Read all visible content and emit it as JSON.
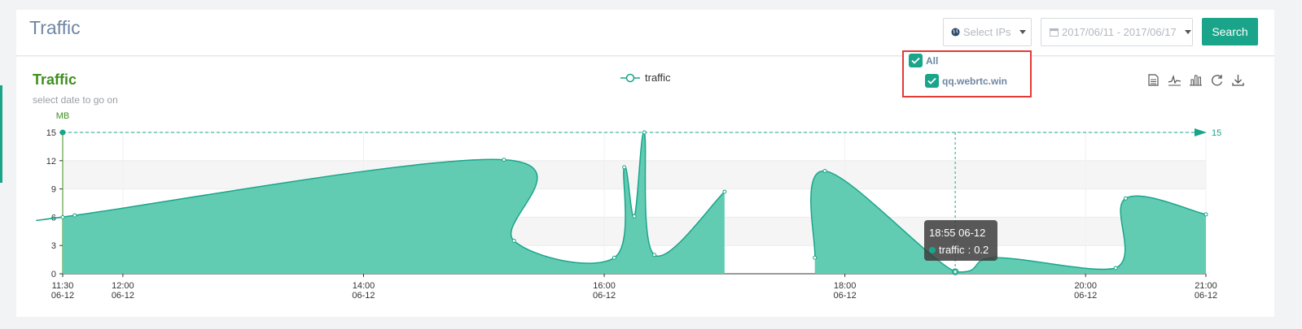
{
  "header": {
    "title": "Traffic",
    "select_ips_label": "Select IPs",
    "date_range": "2017/06/11 - 2017/06/17",
    "search_label": "Search"
  },
  "ip_dropdown": {
    "all_label": "All",
    "items": [
      "qq.webrtc.win"
    ],
    "all_checked": true
  },
  "chart": {
    "title": "Traffic",
    "subtitle": "select date to go on",
    "unit": "MB",
    "legend": "traffic",
    "toolbox_icons": [
      "data-view-icon",
      "line-chart-icon",
      "bar-chart-icon",
      "restore-icon",
      "download-icon"
    ],
    "markline_label": "15",
    "tooltip": {
      "time": "18:55 06-12",
      "series": "traffic",
      "value": "0.2"
    },
    "accent": "#1aa58a"
  },
  "chart_data": {
    "type": "area",
    "title": "Traffic",
    "subtitle": "select date to go on",
    "ylabel": "MB",
    "ylim": [
      0,
      15
    ],
    "yticks": [
      0,
      3,
      6,
      9,
      12,
      15
    ],
    "xlim": [
      "11:30",
      "21:00"
    ],
    "xticks": [
      {
        "time": "11:30",
        "date": "06-12"
      },
      {
        "time": "12:00",
        "date": "06-12"
      },
      {
        "time": "14:00",
        "date": "06-12"
      },
      {
        "time": "16:00",
        "date": "06-12"
      },
      {
        "time": "18:00",
        "date": "06-12"
      },
      {
        "time": "20:00",
        "date": "06-12"
      },
      {
        "time": "21:00",
        "date": "06-12"
      }
    ],
    "series": [
      {
        "name": "traffic",
        "segments": [
          [
            [
              "11:30",
              6.0
            ],
            [
              "11:36",
              6.2
            ],
            [
              "15:10",
              12.1
            ],
            [
              "15:15",
              3.5
            ],
            [
              "16:05",
              1.7
            ],
            [
              "16:10",
              11.3
            ],
            [
              "16:15",
              6.1
            ],
            [
              "16:20",
              15.0
            ],
            [
              "16:25",
              2.0
            ],
            [
              "17:00",
              8.7
            ]
          ],
          [
            [
              "17:45",
              1.7
            ],
            [
              "17:50",
              10.9
            ],
            [
              "18:55",
              0.2
            ],
            [
              "19:15",
              1.7
            ],
            [
              "20:15",
              0.6
            ],
            [
              "20:20",
              8.0
            ],
            [
              "21:00",
              6.3
            ]
          ]
        ]
      }
    ],
    "markline": {
      "value": 15,
      "label": "15"
    },
    "tooltip": {
      "time": "18:55 06-12",
      "series": "traffic",
      "value": 0.2
    }
  }
}
